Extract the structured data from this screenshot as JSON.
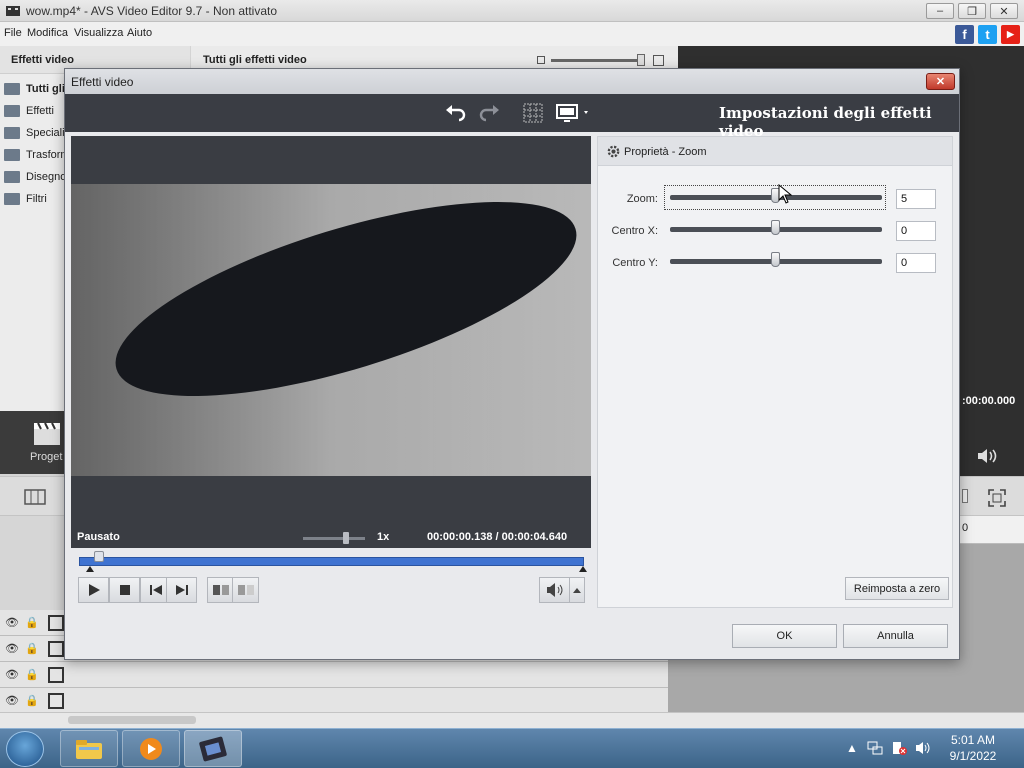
{
  "app": {
    "title": "wow.mp4* - AVS Video Editor 9.7 - Non attivato",
    "window_controls": [
      "–",
      "❐",
      "✕"
    ]
  },
  "menu": [
    "File",
    "Modifica",
    "Visualizza",
    "Aiuto"
  ],
  "social": [
    {
      "name": "facebook",
      "glyph": "f",
      "color": "#3b5998"
    },
    {
      "name": "twitter",
      "glyph": "t",
      "color": "#1da1f2"
    },
    {
      "name": "youtube",
      "glyph": "▶",
      "color": "#e62117"
    }
  ],
  "left_panel": {
    "header": "Effetti video",
    "items": [
      "Tutti gli effetti",
      "Effetti",
      "Speciali",
      "Trasformazione",
      "Disegno",
      "Filtri"
    ]
  },
  "center_panel": {
    "header": "Tutti gli effetti video"
  },
  "right_area": {
    "time": ":00:00.000"
  },
  "project": {
    "label": "Proget"
  },
  "timeline": {
    "ruler_zero": "0"
  },
  "dialog": {
    "title": "Effetti video",
    "close_glyph": "✕",
    "heading": "Impostazioni degli effetti video",
    "preview": {
      "status": "Pausato",
      "speed": "1x",
      "current_time": "00:00:00.138",
      "separator": "/",
      "total_time": "00:00:04.640",
      "progress": 0.03
    },
    "properties": {
      "title": "Proprietà - Zoom",
      "params": [
        {
          "label": "Zoom:",
          "value": "5",
          "level": 0.5,
          "focused": true
        },
        {
          "label": "Centro X:",
          "value": "0",
          "level": 0.5
        },
        {
          "label": "Centro Y:",
          "value": "0",
          "level": 0.5
        }
      ],
      "reset_label": "Reimposta a zero"
    },
    "ok_label": "OK",
    "cancel_label": "Annulla"
  },
  "taskbar": {
    "time": "5:01 AM",
    "date": "9/1/2022"
  }
}
